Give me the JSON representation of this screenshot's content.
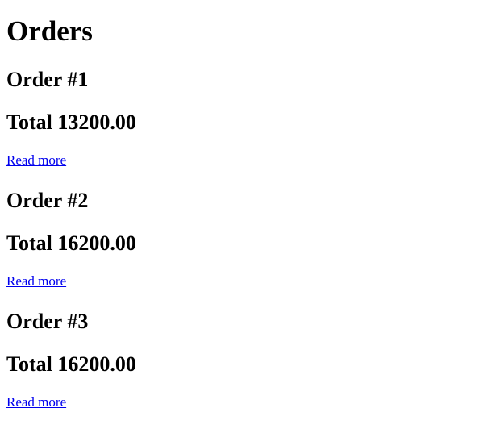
{
  "page": {
    "title": "Orders"
  },
  "orders": [
    {
      "title": "Order #1",
      "total": "Total 13200.00",
      "link": "Read more"
    },
    {
      "title": "Order #2",
      "total": "Total 16200.00",
      "link": "Read more"
    },
    {
      "title": "Order #3",
      "total": "Total 16200.00",
      "link": "Read more"
    }
  ]
}
